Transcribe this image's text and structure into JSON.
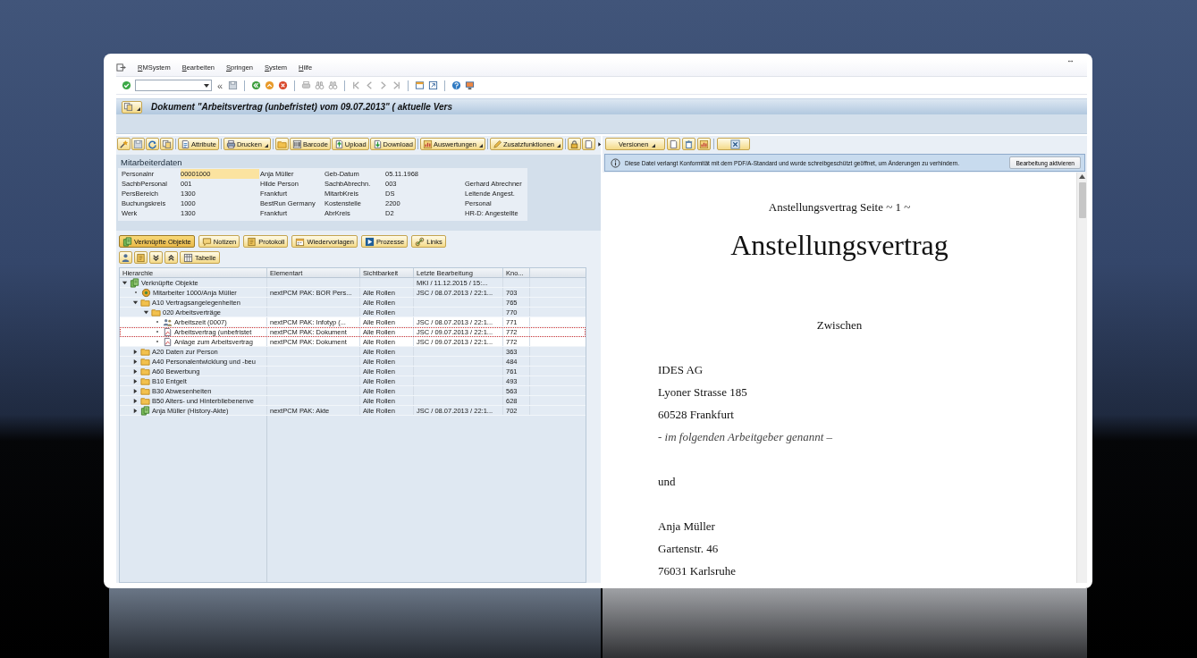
{
  "window": {
    "resize_glyph": "↔"
  },
  "menu": [
    "RMSystem",
    "Bearbeiten",
    "Springen",
    "System",
    "Hilfe"
  ],
  "system_toolbar": {
    "collapse_glyph": "«"
  },
  "title": "Dokument \"Arbeitsvertrag (unbefristet) vom 09.07.2013\" ( aktuelle Vers",
  "left_toolbar": {
    "groups": [
      [
        {
          "kind": "icon"
        },
        {
          "kind": "icon"
        },
        {
          "kind": "icon"
        },
        {
          "kind": "icon"
        }
      ],
      [
        {
          "kind": "text",
          "label": "Attribute",
          "dropdown": false
        }
      ],
      [
        {
          "kind": "text",
          "label": "Drucken",
          "dropdown": true
        }
      ],
      [
        {
          "kind": "icon"
        },
        {
          "kind": "text",
          "label": "Barcode",
          "dropdown": false
        },
        {
          "kind": "text",
          "label": "Upload",
          "dropdown": false
        },
        {
          "kind": "text",
          "label": "Download",
          "dropdown": false
        }
      ],
      [
        {
          "kind": "text",
          "label": "Auswertungen",
          "dropdown": true
        }
      ],
      [
        {
          "kind": "text",
          "label": "Zusatzfunktionen",
          "dropdown": true
        }
      ],
      [
        {
          "kind": "icon"
        },
        {
          "kind": "icon"
        },
        {
          "kind": "more"
        }
      ]
    ]
  },
  "employee_data": {
    "heading": "Mitarbeiterdaten",
    "rows": [
      {
        "label": "Personalnr",
        "value": "00001000",
        "name": "Anja Müller",
        "label2": "Geb-Datum",
        "value2": "05.11.1968",
        "focused": true
      },
      {
        "label": "SachbPersonal",
        "value": "001",
        "name": "Hilde Person",
        "label2": "SachbAbrechn.",
        "value2": "003",
        "text": "Gerhard Abrechner",
        "focused": false
      },
      {
        "label": "PersBereich",
        "value": "1300",
        "name": "Frankfurt",
        "label2": "MitarbKreis",
        "value2": "DS",
        "text": "Leitende Angest.",
        "focused": false
      },
      {
        "label": "Buchungskreis",
        "value": "1000",
        "name": "BestRun Germany",
        "label2": "Kostenstelle",
        "value2": "2200",
        "text": "Personal",
        "focused": false
      },
      {
        "label": "Werk",
        "value": "1300",
        "name": "Frankfurt",
        "label2": "AbrKreis",
        "value2": "D2",
        "text": "HR-D: Angestellte",
        "focused": false
      }
    ]
  },
  "tabs": [
    {
      "label": "Verknüpfte Objekte",
      "selected": true
    },
    {
      "label": "Notizen",
      "selected": false
    },
    {
      "label": "Protokoll",
      "selected": false
    },
    {
      "label": "Wiedervorlagen",
      "selected": false
    },
    {
      "label": "Prozesse",
      "selected": false
    },
    {
      "label": "Links",
      "selected": false
    }
  ],
  "tree_toolbar": {
    "groups": [
      [
        {
          "kind": "icon"
        },
        {
          "kind": "icon"
        },
        {
          "kind": "icon"
        },
        {
          "kind": "icon"
        },
        {
          "kind": "text",
          "label": "Tabelle",
          "dropdown": false
        }
      ]
    ]
  },
  "tree": {
    "columns": [
      "Hierarchie",
      "Elementart",
      "Sichtbarkeit",
      "Letzte Bearbeitung",
      "Kno..."
    ],
    "rows": [
      {
        "kind": "objects",
        "label": "Verknüpfte Objekte",
        "last_edited": "MKI / 11.12.2015 / 15:...",
        "expanded": true,
        "selected": false,
        "children": [
          {
            "kind": "object",
            "label": "Mitarbeiter 1000/Anja Müller",
            "element_type": "nextPCM PAK: BOR Pers...",
            "visibility": "Alle Rollen",
            "last_edited": "JSC / 08.07.2013 / 22:1...",
            "node_no": "703",
            "selected": false
          },
          {
            "kind": "folder",
            "label": "A10 Vertragsangelegenheiten",
            "visibility": "Alle Rollen",
            "node_no": "765",
            "expanded": true,
            "selected": false,
            "children": [
              {
                "kind": "folder",
                "label": "020 Arbeitsverträge",
                "visibility": "Alle Rollen",
                "node_no": "770",
                "expanded": true,
                "selected": false,
                "children": [
                  {
                    "kind": "people",
                    "label": "Arbeitszeit (0007)",
                    "element_type": "nextPCM PAK: Infotyp (...",
                    "visibility": "Alle Rollen",
                    "last_edited": "JSC / 08.07.2013 / 22:1...",
                    "node_no": "771",
                    "selected": false
                  },
                  {
                    "kind": "document",
                    "label": "Arbeitsvertrag (unbefristet",
                    "element_type": "nextPCM PAK: Dokument",
                    "visibility": "Alle Rollen",
                    "last_edited": "JSC / 09.07.2013 / 22:1...",
                    "node_no": "772",
                    "selected": true
                  },
                  {
                    "kind": "document",
                    "label": "Anlage zum Arbeitsvertrag",
                    "element_type": "nextPCM PAK: Dokument",
                    "visibility": "Alle Rollen",
                    "last_edited": "JSC / 09.07.2013 / 22:1...",
                    "node_no": "772",
                    "selected": false
                  }
                ]
              }
            ]
          },
          {
            "kind": "folder",
            "label": "A20 Daten zur Person",
            "visibility": "Alle Rollen",
            "node_no": "363",
            "expanded": false,
            "selected": false
          },
          {
            "kind": "folder",
            "label": "A40 Personalentwicklung und -beu",
            "visibility": "Alle Rollen",
            "node_no": "484",
            "expanded": false,
            "selected": false
          },
          {
            "kind": "folder",
            "label": "A60 Bewerbung",
            "visibility": "Alle Rollen",
            "node_no": "761",
            "expanded": false,
            "selected": false
          },
          {
            "kind": "folder",
            "label": "B10 Entgelt",
            "visibility": "Alle Rollen",
            "node_no": "493",
            "expanded": false,
            "selected": false
          },
          {
            "kind": "folder",
            "label": "B30 Abwesenheiten",
            "visibility": "Alle Rollen",
            "node_no": "563",
            "expanded": false,
            "selected": false
          },
          {
            "kind": "folder",
            "label": "B50 Alters- und Hinterbliebenenve",
            "visibility": "Alle Rollen",
            "node_no": "628",
            "expanded": false,
            "selected": false
          },
          {
            "kind": "objects",
            "label": "Anja Müller (History-Akte)",
            "element_type": "nextPCM PAK: Akte",
            "visibility": "Alle Rollen",
            "last_edited": "JSC / 08.07.2013 / 22:1...",
            "node_no": "702",
            "expanded": false,
            "selected": false
          }
        ]
      }
    ]
  },
  "versions_toolbar": {
    "groups": [
      [
        {
          "kind": "text",
          "label": "Versionen",
          "dropdown": true
        },
        {
          "kind": "icon"
        },
        {
          "kind": "icon"
        },
        {
          "kind": "icon"
        }
      ],
      [
        {
          "kind": "icon"
        }
      ]
    ]
  },
  "info_bar": {
    "message": "Diese Datei verlangt Konformität mit dem PDF/A-Standard und wurde schreibgeschützt geöffnet, um Änderungen zu verhindern.",
    "button": "Bearbeitung aktivieren"
  },
  "document": {
    "blocks": [
      {
        "kind": "page-header",
        "lines": [
          {
            "text": "Anstellungsvertrag Seite ~ 1 ~"
          }
        ]
      },
      {
        "kind": "title",
        "lines": [
          {
            "text": "Anstellungsvertrag"
          }
        ]
      },
      {
        "kind": "centered",
        "lines": [
          {
            "text": "Zwischen"
          }
        ]
      },
      {
        "kind": "left",
        "lines": [
          {
            "text": "IDES AG"
          },
          {
            "text": "Lyoner Strasse 185"
          },
          {
            "text": "60528 Frankfurt"
          },
          {
            "text": "- im folgenden Arbeitgeber genannt –",
            "italic": true
          }
        ]
      },
      {
        "kind": "left",
        "lines": [
          {
            "text": "und"
          }
        ]
      },
      {
        "kind": "left",
        "lines": [
          {
            "text": "Anja Müller"
          },
          {
            "text": "Gartenstr. 46"
          },
          {
            "text": "76031 Karlsruhe"
          }
        ]
      }
    ]
  }
}
